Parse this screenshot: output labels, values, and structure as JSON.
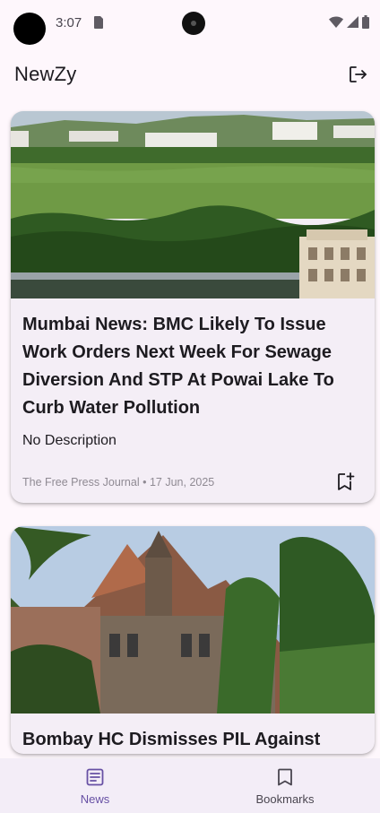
{
  "status_bar": {
    "time": "3:07",
    "icons": [
      "sim-card-icon",
      "wifi-icon",
      "cell-signal-icon",
      "battery-icon"
    ]
  },
  "app_bar": {
    "title": "NewZy",
    "action_icon": "logout-icon"
  },
  "articles": [
    {
      "title": "Mumbai News: BMC Likely To Issue Work Orders Next Week For Sewage Diversion And STP At Powai Lake To Curb Water Pollution",
      "description": "No Description",
      "source": "The Free Press Journal",
      "separator": "•",
      "date": "17 Jun, 2025",
      "image_desc": "Aerial view of Powai Lake with green vegetation and buildings",
      "action_icon": "bookmark-add-icon"
    },
    {
      "title": "Bombay HC Dismisses PIL Against",
      "image_desc": "Bombay High Court gothic building with palm trees"
    }
  ],
  "bottom_nav": {
    "items": [
      {
        "label": "News",
        "icon": "news-icon",
        "active": true
      },
      {
        "label": "Bookmarks",
        "icon": "bookmark-icon",
        "active": false
      }
    ]
  },
  "colors": {
    "background": "#fef7fc",
    "card": "#f4eef6",
    "accent": "#6750a4",
    "text": "#1d1b20",
    "meta": "#8f8a93",
    "nav_bg": "#f3edf7"
  }
}
